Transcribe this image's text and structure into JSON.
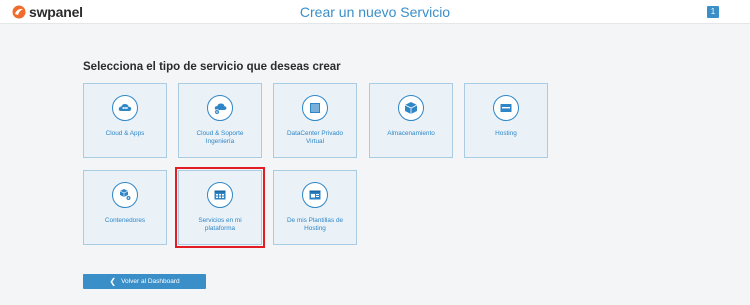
{
  "header": {
    "logo_text": "swpanel",
    "title": "Crear un nuevo Servicio",
    "notification_count": "1"
  },
  "main": {
    "heading": "Selecciona el tipo de servicio que deseas crear",
    "cards": [
      {
        "label": "Cloud & Apps",
        "icon": "cloud-apps-icon"
      },
      {
        "label": "Cloud & Soporte Ingeniería",
        "icon": "cloud-support-icon"
      },
      {
        "label": "DataCenter Privado Virtual",
        "icon": "datacenter-icon"
      },
      {
        "label": "Almacenamiento",
        "icon": "storage-box-icon"
      },
      {
        "label": "Hosting",
        "icon": "hosting-icon"
      },
      {
        "label": "Contenedores",
        "icon": "containers-icon"
      },
      {
        "label": "Servicios en mi plataforma",
        "icon": "platform-services-icon"
      },
      {
        "label": "De mis Plantillas de Hosting",
        "icon": "hosting-templates-icon"
      }
    ],
    "back_button": "Volver al Dashboard"
  },
  "colors": {
    "accent": "#3a8fc9",
    "card_bg": "#eaf2f8",
    "card_border": "#a9cce3",
    "highlight": "#e31b23"
  }
}
